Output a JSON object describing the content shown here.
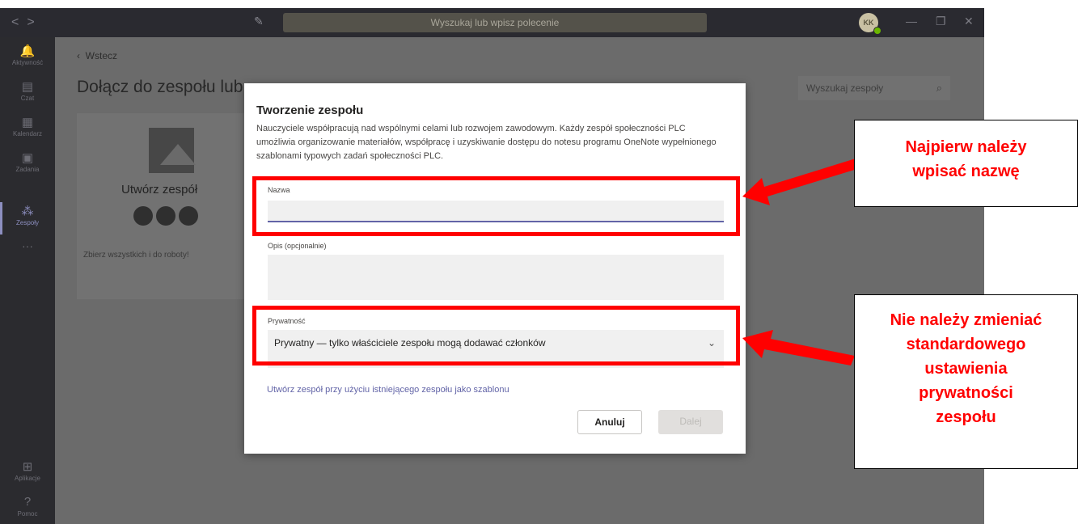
{
  "titlebar": {
    "nav_back": "<",
    "nav_forward": ">",
    "search_placeholder": "Wyszukaj lub wpisz polecenie",
    "avatar_initials": "KK"
  },
  "rail": {
    "items": [
      {
        "label": "Aktywność",
        "icon": "bell-icon"
      },
      {
        "label": "Czat",
        "icon": "chat-icon"
      },
      {
        "label": "Kalendarz",
        "icon": "calendar-icon"
      },
      {
        "label": "Zadania",
        "icon": "assignments-icon"
      },
      {
        "label": "Zespoły",
        "icon": "teams-icon"
      },
      {
        "label": "Aplikacje",
        "icon": "apps-icon"
      },
      {
        "label": "Pomoc",
        "icon": "help-icon"
      }
    ]
  },
  "page": {
    "back_label": "Wstecz",
    "title": "Dołącz do zespołu lub",
    "team_search_placeholder": "Wyszukaj zespoły",
    "card_title": "Utwórz zespół",
    "card_desc": "Zbierz wszystkich i do roboty!"
  },
  "modal": {
    "title": "Tworzenie zespołu",
    "description": "Nauczyciele współpracują nad wspólnymi celami lub rozwojem zawodowym. Każdy zespół społeczności PLC umożliwia organizowanie materiałów, współpracę i uzyskiwanie dostępu do notesu programu OneNote wypełnionego szablonami typowych zadań społeczności PLC.",
    "name_label": "Nazwa",
    "name_value": "",
    "desc_label": "Opis (opcjonalnie)",
    "desc_value": "",
    "privacy_label": "Prywatność",
    "privacy_value": "Prywatny — tylko właściciele zespołu mogą dodawać członków",
    "template_link": "Utwórz zespół przy użyciu istniejącego zespołu jako szablonu",
    "cancel_label": "Anuluj",
    "next_label": "Dalej"
  },
  "annotations": {
    "callout1_lines": [
      "Najpierw należy",
      "wpisać nazwę"
    ],
    "callout2_lines": [
      "Nie należy zmieniać",
      "standardowego",
      "ustawienia",
      "prywatności",
      "zespołu"
    ],
    "highlight_color": "#ff0000"
  }
}
